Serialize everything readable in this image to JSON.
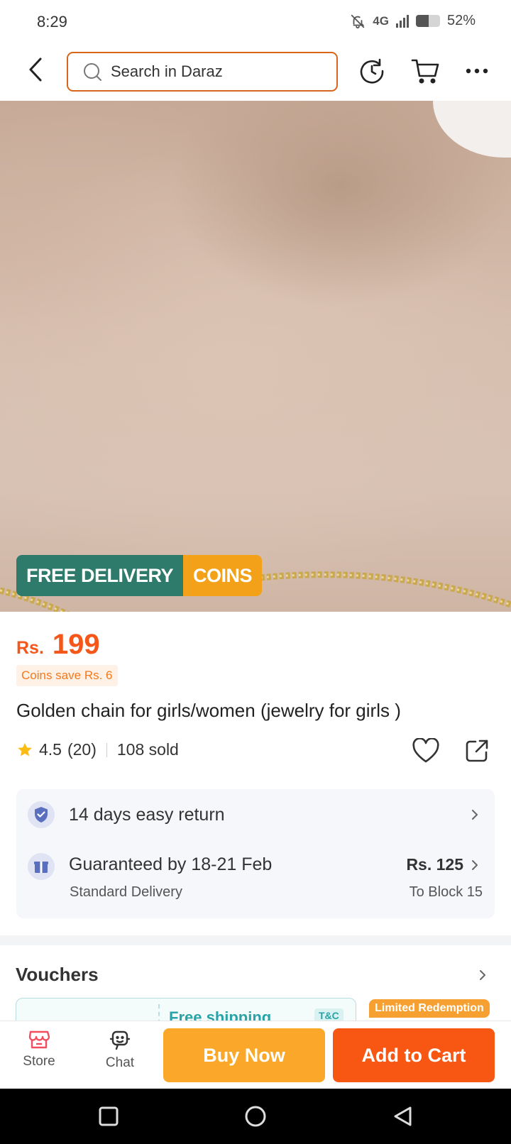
{
  "status_bar": {
    "time": "8:29",
    "network": "4G",
    "battery_percent": "52%",
    "battery_level": 0.52
  },
  "header": {
    "search_placeholder": "Search in Daraz",
    "icons": [
      "back-arrow-icon",
      "search-icon",
      "history-icon",
      "cart-icon",
      "more-icon"
    ]
  },
  "hero": {
    "badge_free": "FREE DELIVERY",
    "badge_coins": "COINS"
  },
  "product": {
    "currency": "Rs.",
    "price": "199",
    "coins_save": "Coins save Rs. 6",
    "title": "Golden chain for girls/women (jewelry for girls )",
    "rating": "4.5",
    "rating_count": "(20)",
    "sold": "108 sold"
  },
  "services": {
    "return": "14 days easy return",
    "delivery_main": "Guaranteed by 18-21 Feb",
    "delivery_sub": "Standard Delivery",
    "delivery_price": "Rs. 125",
    "delivery_location": "To Block 15"
  },
  "vouchers": {
    "title": "Vouchers",
    "card_text": "Free shipping",
    "card_tc": "T&C",
    "limited_tag": "Limited Redemption"
  },
  "action_bar": {
    "store_label": "Store",
    "chat_label": "Chat",
    "buy_now": "Buy Now",
    "add_to_cart": "Add to Cart"
  },
  "colors": {
    "brand_orange": "#f75712",
    "buy_yellow": "#fba82a",
    "badge_green": "#2e7a6b",
    "badge_coins": "#f2a118",
    "price_orange": "#f5571b"
  }
}
